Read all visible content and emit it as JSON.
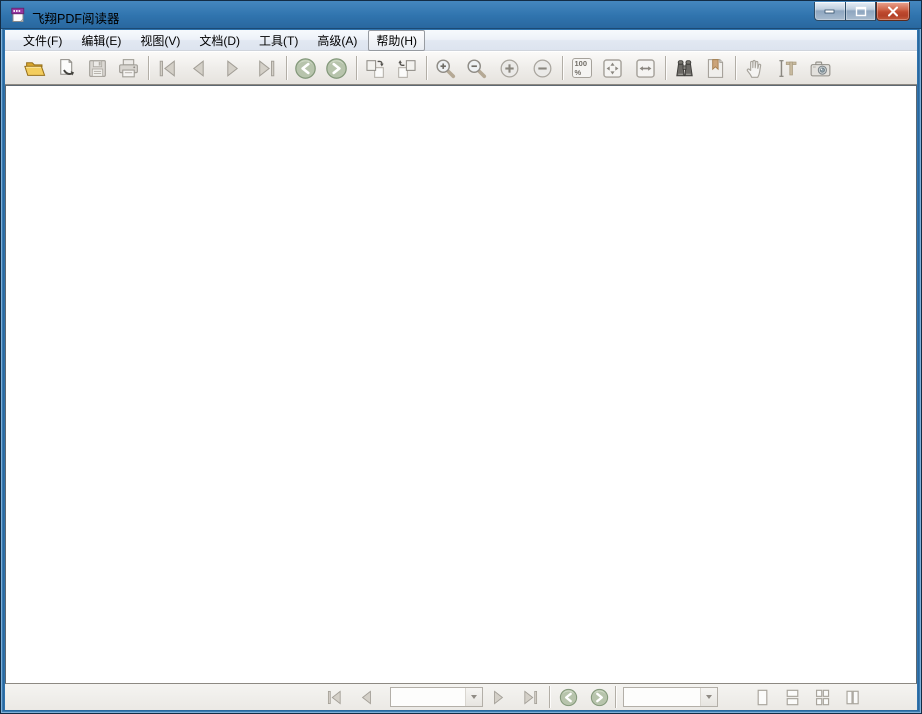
{
  "window": {
    "title": "飞翔PDF阅读器",
    "accent_blue": "#2f73ad",
    "close_red": "#bf4a2f",
    "controls": [
      "minimize",
      "maximize",
      "close"
    ]
  },
  "menubar": {
    "items": [
      {
        "label": "文件(F)"
      },
      {
        "label": "编辑(E)"
      },
      {
        "label": "视图(V)"
      },
      {
        "label": "文档(D)"
      },
      {
        "label": "工具(T)"
      },
      {
        "label": "高级(A)"
      },
      {
        "label": "帮助(H)",
        "state": "highlighted"
      }
    ]
  },
  "toolbar": {
    "groups": [
      {
        "buttons": [
          {
            "name": "open",
            "icon": "folder-open-icon",
            "enabled": true
          },
          {
            "name": "save-as",
            "icon": "save-as-icon",
            "enabled": true
          },
          {
            "name": "save",
            "icon": "floppy-icon",
            "enabled": false
          },
          {
            "name": "print",
            "icon": "printer-icon",
            "enabled": false
          }
        ]
      },
      {
        "buttons": [
          {
            "name": "first-page",
            "icon": "first-page-icon",
            "enabled": false
          },
          {
            "name": "previous-page",
            "icon": "prev-triangle-icon",
            "enabled": false
          },
          {
            "name": "next-page",
            "icon": "next-triangle-icon",
            "enabled": false
          },
          {
            "name": "last-page",
            "icon": "last-page-icon",
            "enabled": false
          }
        ]
      },
      {
        "buttons": [
          {
            "name": "previous-view",
            "icon": "back-circle-icon",
            "enabled": true
          },
          {
            "name": "next-view",
            "icon": "forward-circle-icon",
            "enabled": true
          }
        ]
      },
      {
        "buttons": [
          {
            "name": "rotate-clockwise",
            "icon": "rotate-cw-pages-icon",
            "enabled": true
          },
          {
            "name": "rotate-counterclockwise",
            "icon": "rotate-ccw-pages-icon",
            "enabled": true
          }
        ]
      },
      {
        "buttons": [
          {
            "name": "zoom-in-tool",
            "icon": "magnifier-plus-icon",
            "enabled": false
          },
          {
            "name": "zoom-out-tool",
            "icon": "magnifier-minus-icon",
            "enabled": false
          },
          {
            "name": "zoom-in",
            "icon": "plus-circle-icon",
            "enabled": false
          },
          {
            "name": "zoom-out",
            "icon": "minus-circle-icon",
            "enabled": false
          }
        ]
      },
      {
        "buttons": [
          {
            "name": "actual-size",
            "icon": "actual-size-icon",
            "enabled": false
          },
          {
            "name": "fit-page",
            "icon": "fit-page-icon",
            "enabled": false
          },
          {
            "name": "fit-width",
            "icon": "fit-width-icon",
            "enabled": false
          }
        ]
      },
      {
        "buttons": [
          {
            "name": "find",
            "icon": "binoculars-icon",
            "enabled": true
          },
          {
            "name": "bookmark",
            "icon": "bookmark-icon",
            "enabled": true
          }
        ]
      },
      {
        "buttons": [
          {
            "name": "hand-tool",
            "icon": "hand-icon",
            "enabled": false
          },
          {
            "name": "select-text",
            "icon": "text-select-icon",
            "enabled": false
          },
          {
            "name": "snapshot",
            "icon": "camera-icon",
            "enabled": false
          }
        ]
      }
    ],
    "actual_size_label": {
      "line1": "100",
      "line2": "%"
    }
  },
  "statusbar": {
    "page_combo": {
      "value": "",
      "placeholder": ""
    },
    "zoom_combo": {
      "value": "",
      "placeholder": ""
    },
    "nav_buttons": [
      {
        "name": "first-page",
        "icon": "first-page-icon"
      },
      {
        "name": "previous-page",
        "icon": "prev-triangle-icon"
      },
      {
        "name": "next-page",
        "icon": "next-triangle-icon"
      },
      {
        "name": "last-page",
        "icon": "last-page-icon"
      },
      {
        "name": "previous-view",
        "icon": "back-circle-icon"
      },
      {
        "name": "next-view",
        "icon": "forward-circle-icon"
      }
    ],
    "layout_buttons": [
      {
        "name": "single-page",
        "icon": "single-page-layout-icon"
      },
      {
        "name": "continuous",
        "icon": "continuous-layout-icon"
      },
      {
        "name": "facing",
        "icon": "facing-layout-icon"
      },
      {
        "name": "two-up-continuous",
        "icon": "two-up-layout-icon"
      }
    ]
  }
}
